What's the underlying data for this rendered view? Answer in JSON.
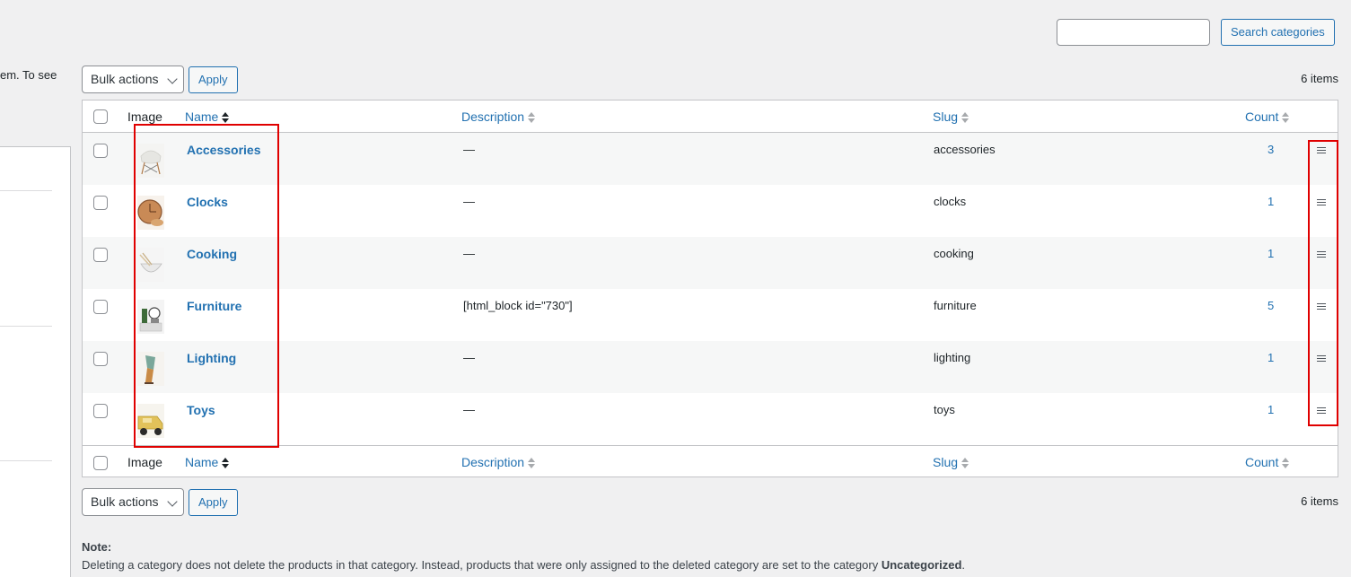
{
  "left": {
    "fragment_text": "em. To see"
  },
  "search": {
    "input_value": "",
    "button_label": "Search categories"
  },
  "bulk": {
    "select_label": "Bulk actions",
    "apply_label": "Apply",
    "items_count": "6 items"
  },
  "columns": {
    "image": "Image",
    "name": "Name",
    "description": "Description",
    "slug": "Slug",
    "count": "Count"
  },
  "rows": [
    {
      "name": "Accessories",
      "description": "—",
      "slug": "accessories",
      "count": "3",
      "image_icon": "chair-thumbnail"
    },
    {
      "name": "Clocks",
      "description": "—",
      "slug": "clocks",
      "count": "1",
      "image_icon": "clock-thumbnail"
    },
    {
      "name": "Cooking",
      "description": "—",
      "slug": "cooking",
      "count": "1",
      "image_icon": "bowl-thumbnail"
    },
    {
      "name": "Furniture",
      "description": "[html_block id=\"730\"]",
      "slug": "furniture",
      "count": "5",
      "image_icon": "shelf-thumbnail"
    },
    {
      "name": "Lighting",
      "description": "—",
      "slug": "lighting",
      "count": "1",
      "image_icon": "lamp-thumbnail"
    },
    {
      "name": "Toys",
      "description": "—",
      "slug": "toys",
      "count": "1",
      "image_icon": "toy-car-thumbnail"
    }
  ],
  "note": {
    "label": "Note:",
    "text_before": "Deleting a category does not delete the products in that category. Instead, products that were only assigned to the deleted category are set to the category ",
    "text_bold": "Uncategorized",
    "text_after": "."
  },
  "colors": {
    "link": "#2271b1",
    "highlight": "#e00000",
    "row_alt": "#f6f7f7"
  }
}
